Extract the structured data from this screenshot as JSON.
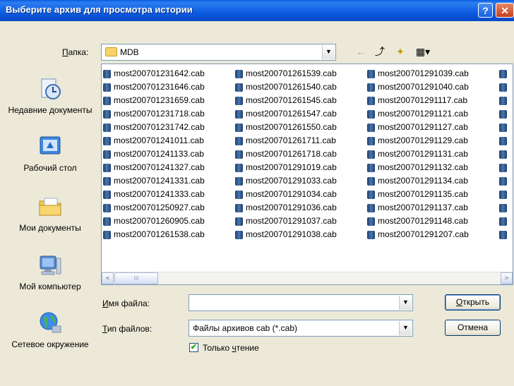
{
  "window": {
    "title": "Выберите архив для просмотра истории",
    "help_label": "?",
    "close_label": "✕"
  },
  "lookin": {
    "label_u": "П",
    "label_rest": "апка:",
    "value": "MDB"
  },
  "toolbar": {
    "back_icon": "←",
    "up_icon": "⤴",
    "newfolder_icon": "✦",
    "views_icon": "▦▾"
  },
  "places": [
    {
      "label": "Недавние документы",
      "icon": "recent-documents-icon"
    },
    {
      "label": "Рабочий стол",
      "icon": "desktop-icon"
    },
    {
      "label": "Мои документы",
      "icon": "my-documents-icon"
    },
    {
      "label": "Мой компьютер",
      "icon": "my-computer-icon"
    },
    {
      "label": "Сетевое окружение",
      "icon": "network-icon"
    }
  ],
  "files": {
    "columns": [
      [
        "most200701231642.cab",
        "most200701231646.cab",
        "most200701231659.cab",
        "most200701231718.cab",
        "most200701231742.cab",
        "most200701241011.cab",
        "most200701241133.cab",
        "most200701241327.cab",
        "most200701241331.cab",
        "most200701241333.cab",
        "most200701250927.cab",
        "most200701260905.cab",
        "most200701261538.cab"
      ],
      [
        "most200701261539.cab",
        "most200701261540.cab",
        "most200701261545.cab",
        "most200701261547.cab",
        "most200701261550.cab",
        "most200701261711.cab",
        "most200701261718.cab",
        "most200701291019.cab",
        "most200701291033.cab",
        "most200701291034.cab",
        "most200701291036.cab",
        "most200701291037.cab",
        "most200701291038.cab"
      ],
      [
        "most200701291039.cab",
        "most200701291040.cab",
        "most200701291117.cab",
        "most200701291121.cab",
        "most200701291127.cab",
        "most200701291129.cab",
        "most200701291131.cab",
        "most200701291132.cab",
        "most200701291134.cab",
        "most200701291135.cab",
        "most200701291137.cab",
        "most200701291148.cab",
        "most200701291207.cab"
      ]
    ],
    "scroll_left": "<",
    "scroll_right": ">",
    "scroll_grip": "III"
  },
  "filename": {
    "label_u": "И",
    "label_rest": "мя файла:",
    "value": ""
  },
  "filetype": {
    "label_u": "Т",
    "label_rest": "ип файлов:",
    "value": "Файлы архивов cab (*.cab)"
  },
  "readonly": {
    "label_before": "Только ",
    "label_u": "ч",
    "label_after": "тение",
    "checked": true,
    "mark": "✔"
  },
  "buttons": {
    "open_u": "О",
    "open_rest": "ткрыть",
    "cancel": "Отмена"
  }
}
